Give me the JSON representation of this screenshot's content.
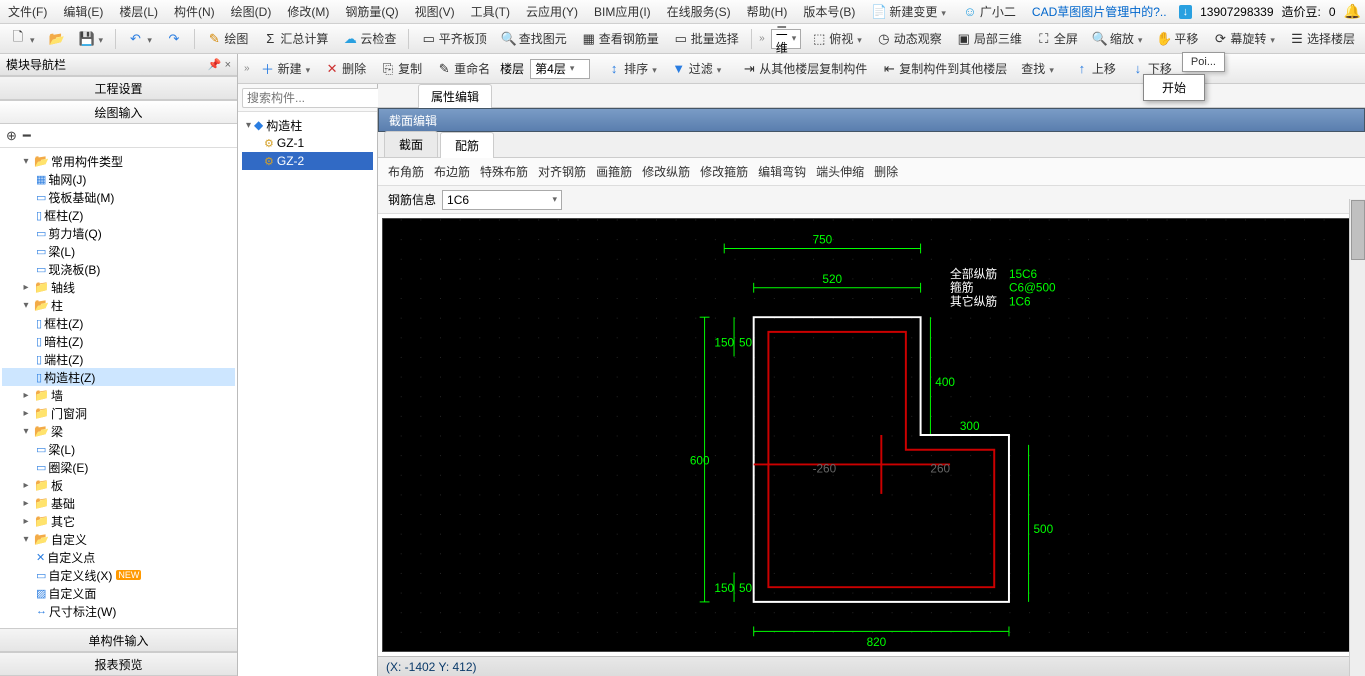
{
  "menu": {
    "items": [
      "文件(F)",
      "编辑(E)",
      "楼层(L)",
      "构件(N)",
      "绘图(D)",
      "修改(M)",
      "钢筋量(Q)",
      "视图(V)",
      "工具(T)",
      "云应用(Y)",
      "BIM应用(I)",
      "在线服务(S)",
      "帮助(H)",
      "版本号(B)"
    ],
    "new_change": "新建变更",
    "agent": "广小二",
    "cad_manage": "CAD草图图片管理中的?..",
    "user": "13907298339",
    "credits_label": "造价豆:",
    "credits_value": "0"
  },
  "toolbar1": {
    "draw": "绘图",
    "sumcalc": "汇总计算",
    "cloudcheck": "云检查",
    "aligntop": "平齐板顶",
    "findelem": "查找图元",
    "viewrebar": "查看钢筋量",
    "batchsel": "批量选择",
    "view2d": "二维",
    "topview": "俯视",
    "dynview": "动态观察",
    "local3d": "局部三维",
    "fullscreen": "全屏",
    "zoom": "缩放",
    "pan": "平移",
    "rotate": "幕旋转",
    "selfloor": "选择楼层",
    "tooltip": "Poi...",
    "start": "开始"
  },
  "toolbar2": {
    "new": "新建",
    "delete": "删除",
    "copy": "复制",
    "rename": "重命名",
    "floor_label": "楼层",
    "floor_value": "第4层",
    "sort": "排序",
    "filter": "过滤",
    "copyfrom": "从其他楼层复制构件",
    "copyto": "复制构件到其他楼层",
    "find": "查找",
    "up": "上移",
    "down": "下移"
  },
  "left": {
    "nav_title": "模块导航栏",
    "proj_settings": "工程设置",
    "draw_input": "绘图输入",
    "single_input": "单构件输入",
    "report_preview": "报表预览",
    "tree": {
      "common": "常用构件类型",
      "axisnet": "轴网(J)",
      "raft": "筏板基础(M)",
      "framecol": "框柱(Z)",
      "shearwall": "剪力墙(Q)",
      "beam": "梁(L)",
      "slab": "现浇板(B)",
      "axis": "轴线",
      "column": "柱",
      "framecol2": "框柱(Z)",
      "darkcol": "暗柱(Z)",
      "endcol": "端柱(Z)",
      "conscol": "构造柱(Z)",
      "wall": "墙",
      "opening": "门窗洞",
      "beamcat": "梁",
      "beam2": "梁(L)",
      "ringbeam": "圈梁(E)",
      "plate": "板",
      "foundation": "基础",
      "other": "其它",
      "custom": "自定义",
      "custpt": "自定义点",
      "custline": "自定义线(X)",
      "custface": "自定义面",
      "dim": "尺寸标注(W)",
      "new": "NEW"
    }
  },
  "mid": {
    "search_placeholder": "搜索构件...",
    "root": "构造柱",
    "gz1": "GZ-1",
    "gz2": "GZ-2"
  },
  "right": {
    "prop_tab": "属性编辑",
    "section_title": "截面编辑",
    "tab_section": "截面",
    "tab_rebar": "配筋",
    "rtb": [
      "布角筋",
      "布边筋",
      "特殊布筋",
      "对齐钢筋",
      "画箍筋",
      "修改纵筋",
      "修改箍筋",
      "编辑弯钩",
      "端头伸缩",
      "删除"
    ],
    "rebar_info_label": "钢筋信息",
    "rebar_info_value": "1C6",
    "legend": {
      "all_long": "全部纵筋",
      "all_long_val": "15C6",
      "stirrup": "箍筋",
      "stirrup_val": "C6@500",
      "other_long": "其它纵筋",
      "other_long_val": "1C6"
    },
    "dims": {
      "top": "750",
      "w520": "520",
      "h150a": "150",
      "o50a": "50",
      "h600": "600",
      "h400": "400",
      "w300": "300",
      "h500": "500",
      "h150b": "150",
      "o50b": "50",
      "bot": "820",
      "n260": "-260",
      "p260": "260"
    },
    "status": "(X: -1402 Y: 412)"
  }
}
